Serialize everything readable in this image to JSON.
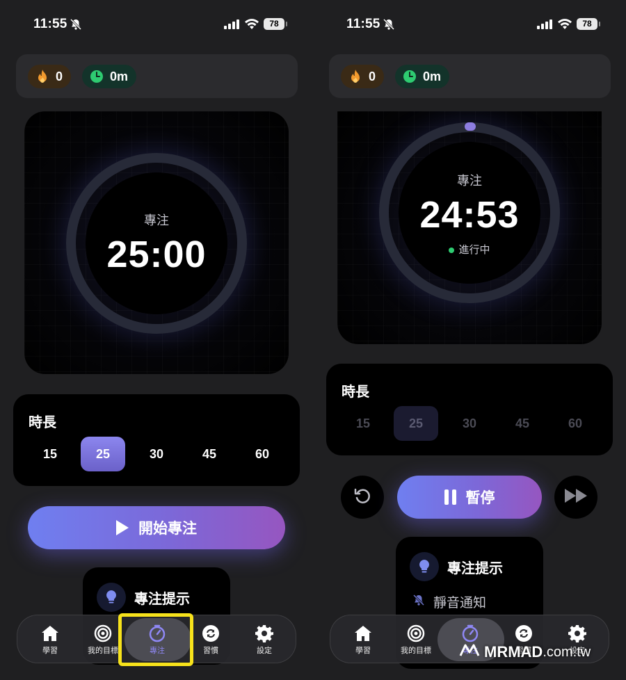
{
  "status_bar": {
    "time": "11:55",
    "battery": "78"
  },
  "stats": {
    "streak": "0",
    "focus_time": "0m"
  },
  "timer_idle": {
    "mode": "專注",
    "time": "25:00"
  },
  "timer_running": {
    "mode": "專注",
    "time": "24:53",
    "state": "進行中"
  },
  "duration": {
    "title": "時長",
    "options": [
      "15",
      "25",
      "30",
      "45",
      "60"
    ],
    "selected": "25"
  },
  "actions": {
    "start": "開始專注",
    "pause": "暫停"
  },
  "tips": {
    "title": "專注提示",
    "mute": "靜音通知"
  },
  "tabbar": {
    "items": [
      "學習",
      "我的目標",
      "專注",
      "習慣",
      "設定"
    ],
    "active": "專注"
  },
  "watermark": {
    "brand": "MRMAD",
    "domain": ".com.tw"
  },
  "colors": {
    "accent": "#8f88f5",
    "highlight": "#f7e21b",
    "running_dot": "#2ecc71"
  }
}
